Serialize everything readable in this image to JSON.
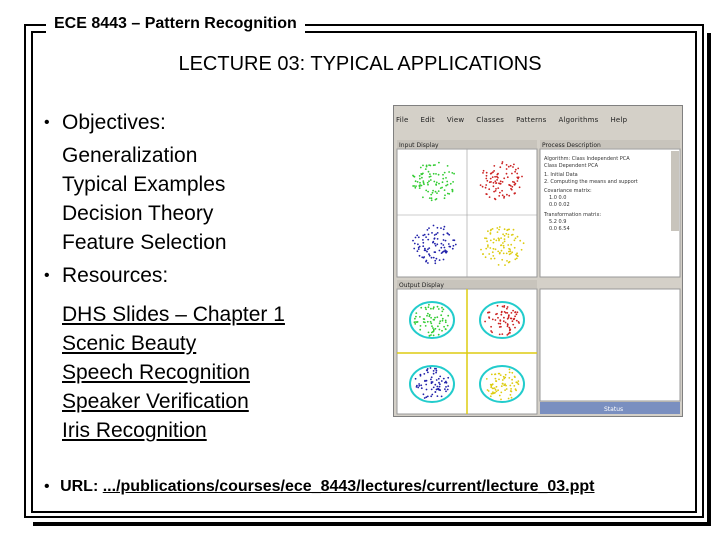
{
  "header": {
    "course_title": "ECE 8443 – Pattern Recognition"
  },
  "slide": {
    "title": "LECTURE 03: TYPICAL APPLICATIONS",
    "objectives": {
      "heading": "Objectives:",
      "items": [
        "Generalization",
        "Typical Examples",
        "Decision Theory",
        "Feature Selection"
      ]
    },
    "resources": {
      "heading": "Resources:",
      "items": [
        "DHS Slides – Chapter 1",
        "Scenic Beauty",
        "Speech Recognition",
        "Speaker Verification",
        "Iris Recognition"
      ]
    },
    "url": {
      "label": "URL:",
      "link": ".../publications/courses/ece_8443/lectures/current/lecture_03.ppt"
    }
  },
  "screenshot": {
    "menu": [
      "File",
      "Edit",
      "View",
      "Classes",
      "Patterns",
      "Algorithms",
      "Help"
    ],
    "panels": [
      "Input Display",
      "Process Description",
      "Output Display"
    ],
    "description_lines": [
      "Algorithm: Class Independent PCA",
      "Class Dependent PCA",
      "1. Initial Data",
      "2. Computing the means and support",
      "Covariance matrix:",
      "1.0  0.0",
      "0.0  0.02",
      "Transformation matrix:",
      "5.2  0.9",
      "0.0  6.54"
    ],
    "status": "Status",
    "cluster_colors": [
      "#33cc33",
      "#cc2222",
      "#2222aa",
      "#ddcc11"
    ],
    "ring_color": "#22cccc"
  }
}
